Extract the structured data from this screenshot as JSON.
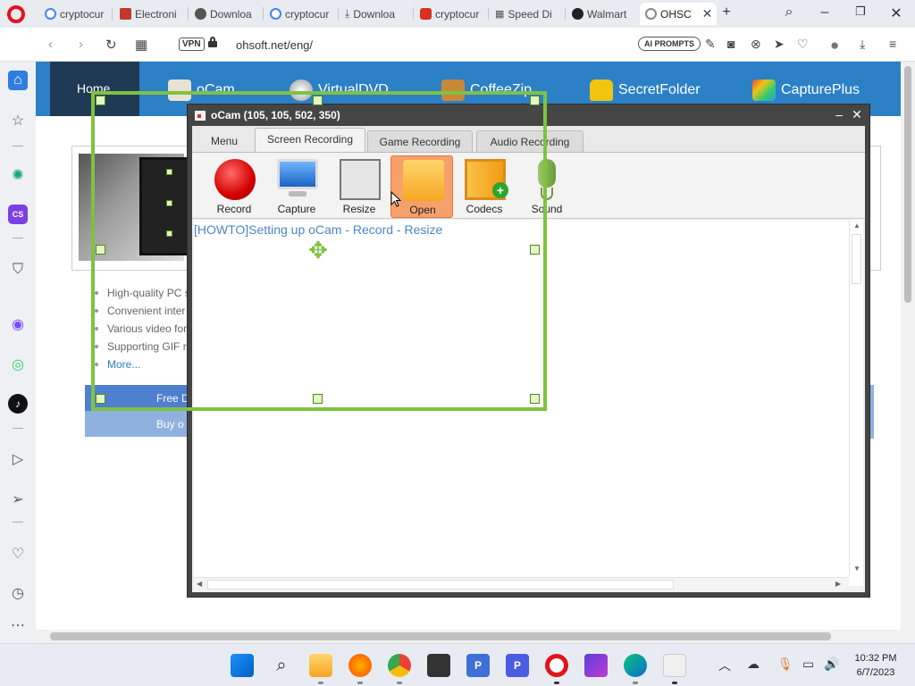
{
  "browser": {
    "tabs": [
      {
        "label": "cryptocur",
        "color": "#4285f4"
      },
      {
        "label": "Electroni",
        "color": "#c0392b"
      },
      {
        "label": "Downloa",
        "color": "#666666"
      },
      {
        "label": "cryptocur",
        "color": "#4285f4"
      },
      {
        "label": "Downloa",
        "color": "#666666"
      },
      {
        "label": "cryptocur",
        "color": "#d93025"
      },
      {
        "label": "Speed Di",
        "color": "#555555"
      },
      {
        "label": "Walmart",
        "color": "#222222"
      },
      {
        "label": "OHSC",
        "color": "#888888"
      }
    ],
    "url": "ohsoft.net/eng/",
    "vpn_label": "VPN",
    "ai_prompts_label": "AI PROMPTS"
  },
  "site": {
    "nav": {
      "home": "Home",
      "items": [
        "oCam",
        "VirtualDVD",
        "CoffeeZip",
        "SecretFolder",
        "CapturePlus"
      ]
    },
    "features": [
      "High-quality PC s",
      "Convenient inter",
      "Various video for",
      "Supporting GIF r",
      "More..."
    ],
    "buttons": [
      "Free D",
      "Buy o"
    ]
  },
  "ocam": {
    "title": "oCam (105, 105, 502, 350)",
    "tabs": [
      "Menu",
      "Screen Recording",
      "Game Recording",
      "Audio Recording"
    ],
    "tools": [
      "Record",
      "Capture",
      "Resize",
      "Open",
      "Codecs",
      "Sound"
    ],
    "howto_link": "[HOWTO]Setting up oCam - Record - Resize"
  },
  "taskbar": {
    "time": "10:32 PM",
    "date": "6/7/2023"
  },
  "colors": {
    "accent_blue": "#2b80c6",
    "capture_green": "#7fc241",
    "opera_red": "#e3131b"
  }
}
